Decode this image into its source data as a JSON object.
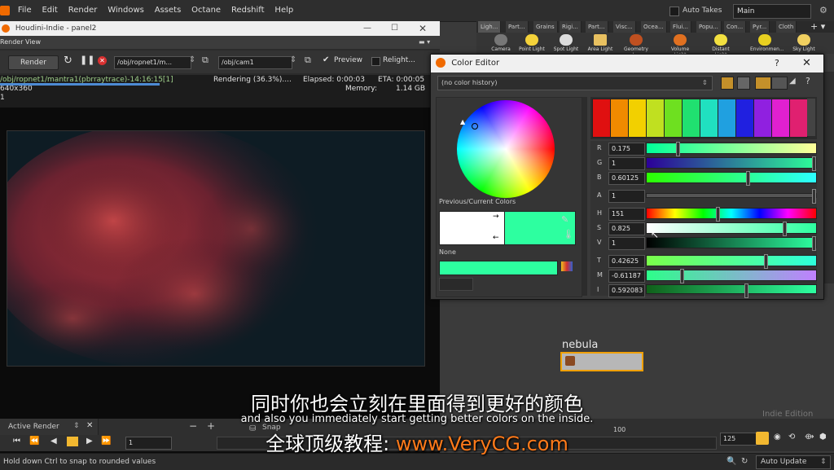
{
  "menubar": {
    "items": [
      "File",
      "Edit",
      "Render",
      "Windows",
      "Assets",
      "Octane",
      "Redshift",
      "Help"
    ],
    "auto_takes": "Auto Takes",
    "desktop": "Main"
  },
  "shelf": {
    "tabs": [
      "Ligh...",
      "Part...",
      "Grains",
      "Rigi...",
      "Part...",
      "Visc...",
      "Ocea...",
      "Flui...",
      "Popu...",
      "Con...",
      "Pyr...",
      "Cloth"
    ],
    "tools": [
      "Camera",
      "Point Light",
      "Spot Light",
      "Area Light",
      "Geometry L...",
      "Volume Light",
      "Distant Light",
      "Environmen...",
      "Sky Light"
    ]
  },
  "render_window": {
    "title": "Houdini-Indie - panel2",
    "tab": "Render View",
    "render_label": "Render",
    "rop_path": "/obj/ropnet1/m...",
    "camera_path": "/obj/cam1",
    "preview_label": "Preview",
    "relight_label": "Relight...",
    "status_path": "/obj/ropnet1/mantra1(pbrraytrace)-14:16:15[1]",
    "status_rendering": "Rendering (36.3%)....",
    "status_elapsed": "Elapsed: 0:00:03",
    "status_eta": "ETA: 0:00:05",
    "status_res": "640x360",
    "status_memory_label": "Memory:",
    "status_memory": "1.14 GB",
    "status_frame": "1",
    "progress_fraction": 0.363
  },
  "color_editor": {
    "title": "Color Editor",
    "history": "(no color history)",
    "prev_current_label": "Previous/Current Colors",
    "none_label": "None",
    "sliders": [
      {
        "label": "R",
        "value": "0.175"
      },
      {
        "label": "G",
        "value": "1"
      },
      {
        "label": "B",
        "value": "0.60125"
      },
      {
        "label": "A",
        "value": "1"
      },
      {
        "label": "H",
        "value": "151"
      },
      {
        "label": "S",
        "value": "0.825"
      },
      {
        "label": "V",
        "value": "1"
      },
      {
        "label": "T",
        "value": "0.42625"
      },
      {
        "label": "M",
        "value": "-0.61187"
      },
      {
        "label": "I",
        "value": "0.592083"
      }
    ],
    "slider_positions": [
      0.175,
      1,
      0.60125,
      1,
      0.42,
      0.825,
      1,
      0.71,
      0.2,
      0.59
    ],
    "current_color": "#2dffa0",
    "palette": [
      "#e01010",
      "#f08a00",
      "#f2d000",
      "#c0e020",
      "#6ee020",
      "#20e070",
      "#20e0c0",
      "#20a0e0",
      "#2020e0",
      "#9020e0",
      "#e020d0",
      "#e02070"
    ]
  },
  "network": {
    "node_name": "nebula"
  },
  "timeline": {
    "pane_label": "Active Render",
    "frame": "1",
    "end_frame": "125",
    "tick_100": "100",
    "snap_label": "Snap"
  },
  "statusbar": {
    "hint": "Hold down Ctrl to snap to rounded values",
    "auto_update": "Auto Update"
  },
  "watermark": "Indie Edition",
  "subtitles": {
    "chinese": "同时你也会立刻在里面得到更好的颜色",
    "english": "and also you immediately start getting better colors on the inside.",
    "site_prefix": "全球顶级教程:",
    "site_url": "www.VeryCG.com"
  }
}
